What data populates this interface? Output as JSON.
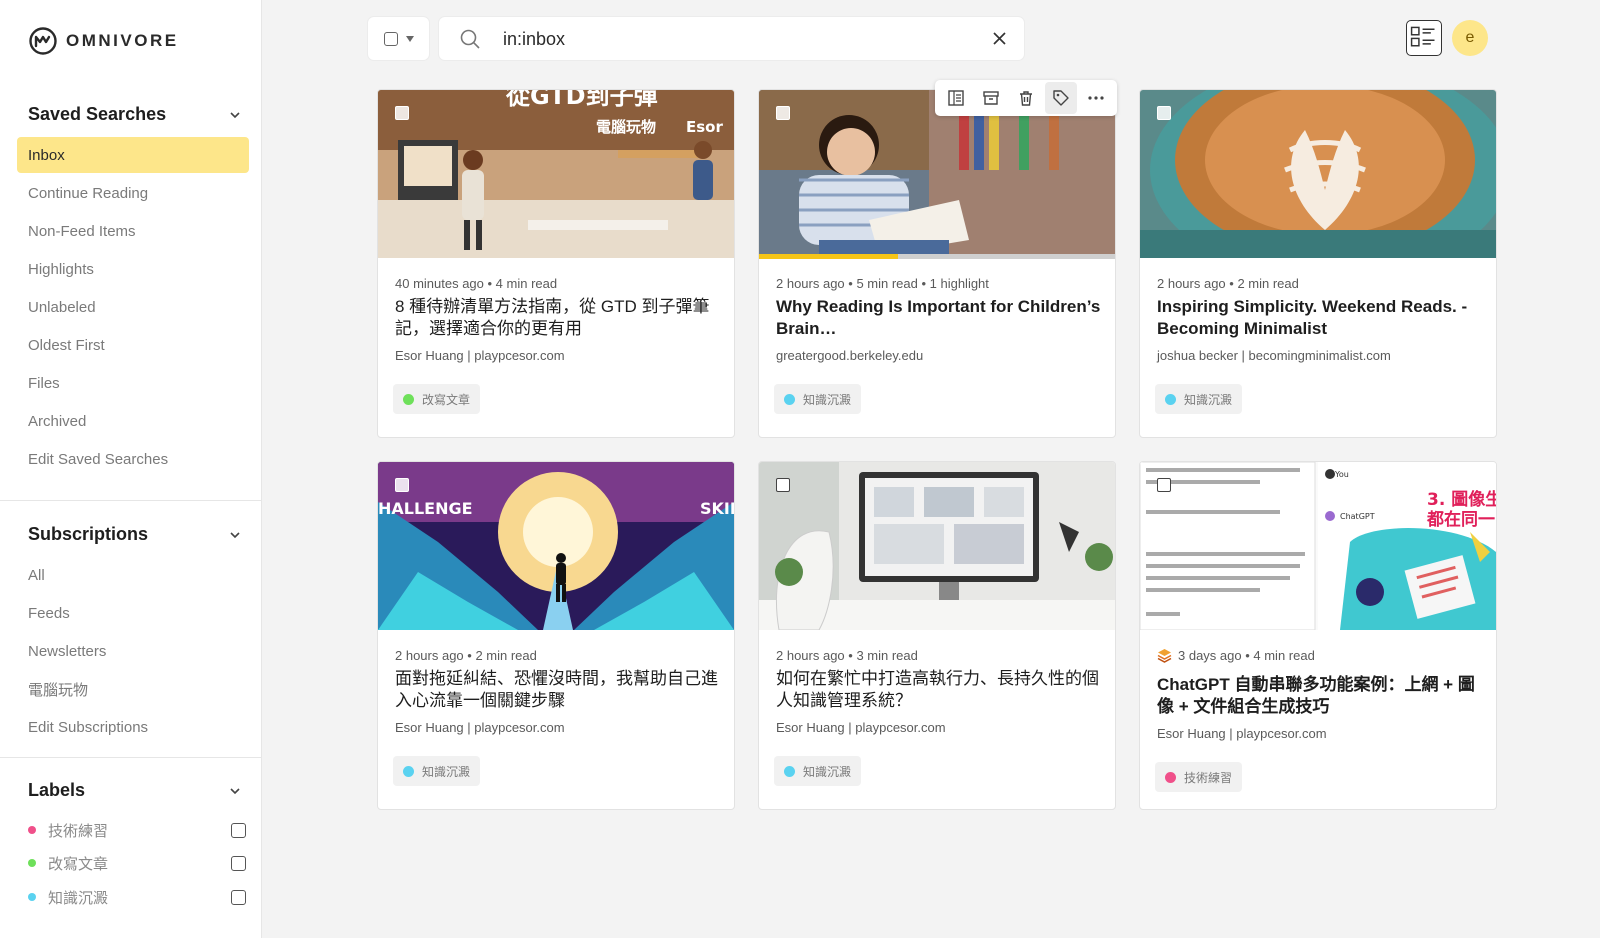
{
  "app": {
    "name": "OMNIVORE"
  },
  "sidebar": {
    "saved_searches": {
      "title": "Saved Searches",
      "items": [
        {
          "label": "Inbox",
          "active": true
        },
        {
          "label": "Continue Reading"
        },
        {
          "label": "Non-Feed Items"
        },
        {
          "label": "Highlights"
        },
        {
          "label": "Unlabeled"
        },
        {
          "label": "Oldest First"
        },
        {
          "label": "Files"
        },
        {
          "label": "Archived"
        },
        {
          "label": "Edit Saved Searches"
        }
      ]
    },
    "subscriptions": {
      "title": "Subscriptions",
      "items": [
        {
          "label": "All"
        },
        {
          "label": "Feeds"
        },
        {
          "label": "Newsletters"
        },
        {
          "label": "電腦玩物"
        },
        {
          "label": "Edit Subscriptions"
        }
      ]
    },
    "labels": {
      "title": "Labels",
      "items": [
        {
          "label": "技術練習",
          "color": "#f0508a"
        },
        {
          "label": "改寫文章",
          "color": "#6ee05a"
        },
        {
          "label": "知識沉澱",
          "color": "#5ad2f0"
        }
      ]
    }
  },
  "search": {
    "value": "in:inbox",
    "placeholder": "Search"
  },
  "user": {
    "initial": "e"
  },
  "cards": [
    {
      "meta": "40 minutes ago • 4 min read",
      "title": "8 種待辦清單方法指南，從 GTD 到子彈筆記，選擇適合你的更有用",
      "source": "Esor Huang | playpcesor.com",
      "tag": "改寫文章",
      "tag_color": "#6ee05a",
      "thumb_text_1": "電腦玩物",
      "thumb_text_2": "Esor",
      "thumb_text_3": "從GTD到子彈"
    },
    {
      "meta": "2 hours ago • 5 min read • 1 highlight",
      "title": "Why Reading Is Important for Children’s Brain…",
      "source": "greatergood.berkeley.edu",
      "tag": "知識沉澱",
      "tag_color": "#5ad2f0",
      "progress": 0.39
    },
    {
      "meta": "2 hours ago • 2 min read",
      "title": "Inspiring Simplicity. Weekend Reads. - Becoming Minimalist",
      "source": "joshua becker | becomingminimalist.com",
      "tag": "知識沉澱",
      "tag_color": "#5ad2f0"
    },
    {
      "meta": "2 hours ago • 2 min read",
      "title": "面對拖延糾結、恐懼沒時間，我幫助自己進入心流靠一個關鍵步驟",
      "source": "Esor Huang | playpcesor.com",
      "tag": "知識沉澱",
      "tag_color": "#5ad2f0",
      "thumb_text_1": "HALLENGE",
      "thumb_text_2": "SKILL"
    },
    {
      "meta": "2 hours ago • 3 min read",
      "title": "如何在繁忙中打造高執行力、長持久性的個人知識管理系統？",
      "source": "Esor Huang | playpcesor.com",
      "tag": "知識沉澱",
      "tag_color": "#5ad2f0"
    },
    {
      "meta": "3 days ago • 4 min read",
      "title": "ChatGPT 自動串聯多功能案例：上網 + 圖像 + 文件組合生成技巧",
      "source": "Esor Huang | playpcesor.com",
      "tag": "技術練習",
      "tag_color": "#f0508a",
      "thumb_text_1": "3. 圖像生",
      "thumb_text_2": "都在同一",
      "thumb_text_3": "You",
      "thumb_text_4": "ChatGPT"
    }
  ]
}
